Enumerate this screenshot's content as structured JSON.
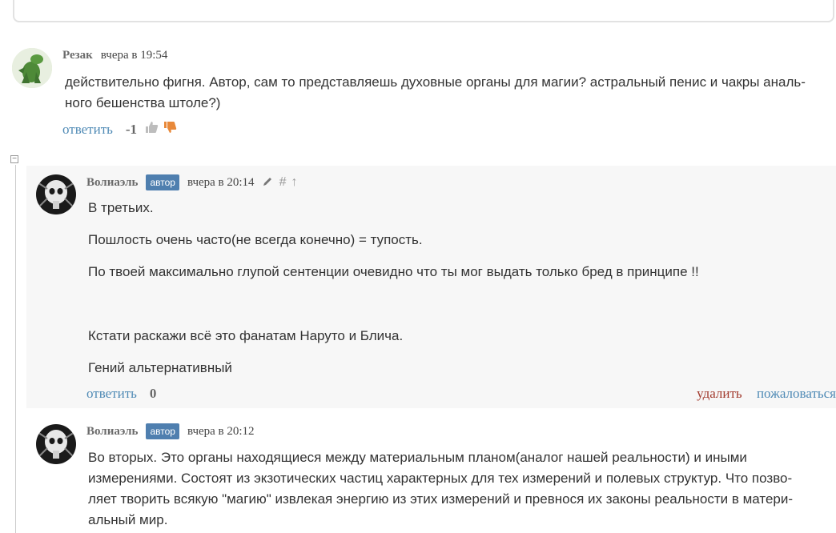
{
  "comments": [
    {
      "author": "Резак",
      "date": "вчера в 19:54",
      "lines": [
        "действительно фигня. Автор, сам то представляешь духовные органы для магии? астральный пенис и чакры аналь-",
        "ного бешенства штоле?)"
      ],
      "reply_label": "ответить",
      "score": "-1"
    },
    {
      "author": "Волиаэль",
      "badge": "автор",
      "date": "вчера в 20:14",
      "paragraphs": [
        "В третьих.",
        "Пошлость очень часто(не всегда конечно) = тупость.",
        "По твоей максимально глупой сентенции очевидно что ты мог выдать только бред в принципе !!",
        "",
        "Кстати раскажи всё это фанатам Наруто и Блича.",
        "Гений альтернативный"
      ],
      "reply_label": "ответить",
      "score": "0",
      "delete_label": "удалить",
      "report_label": "пожаловаться"
    },
    {
      "author": "Волиаэль",
      "badge": "автор",
      "date": "вчера в 20:12",
      "lines": [
        "Во вторых. Это органы находящиеся между материальным планом(аналог нашей реальности) и иными",
        "измерениями. Состоят из экзотических частиц характерных для тех измерений и полевых структур. Что позво-",
        "ляет творить всякую \"магию\" извлекая энергию из этих измерений и превнося их законы реальности в матери-",
        "альный мир."
      ]
    }
  ],
  "colors": {
    "link": "#4f8ab5",
    "badge": "#4f7faf",
    "delete": "#a23b2e",
    "dislike": "#e8893a",
    "like": "#bdbdbd"
  },
  "icons": [
    "thumbs-up-icon",
    "thumbs-down-icon",
    "pencil-icon",
    "hash-icon",
    "arrow-up-icon",
    "collapse-icon"
  ]
}
